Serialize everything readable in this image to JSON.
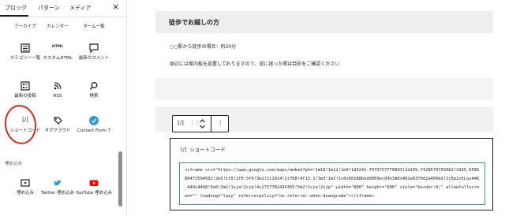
{
  "inserter": {
    "tabs": [
      "ブロック",
      "パターン",
      "メディア"
    ],
    "close_icon": "×",
    "top_row": [
      "アーカイブ",
      "カレンダー",
      "ターム一覧"
    ],
    "rows": [
      {
        "label": "カテゴリー一覧",
        "icon": "category-list-icon"
      },
      {
        "label": "カスタムHTML",
        "icon": "html-icon",
        "icon_text": "HTML"
      },
      {
        "label": "最新のコメント",
        "icon": "comment-icon"
      },
      {
        "label": "最新の投稿",
        "icon": "posts-list-icon"
      },
      {
        "label": "RSS",
        "icon": "rss-icon"
      },
      {
        "label": "検索",
        "icon": "search-icon"
      },
      {
        "label": "ショートコード",
        "icon": "shortcode-icon",
        "icon_text": "[/]"
      },
      {
        "label": "タグクラウド",
        "icon": "tag-icon"
      },
      {
        "label": "Contact Form 7",
        "icon": "contact-form-7-icon"
      }
    ],
    "section_title": "埋め込み",
    "embeds": [
      {
        "label": "埋め込み",
        "icon": "embed-icon"
      },
      {
        "label": "Twitter 埋め込み",
        "icon": "twitter-icon"
      },
      {
        "label": "YouTube 埋め込み",
        "icon": "youtube-icon"
      }
    ],
    "highlight_color": "#e0261b"
  },
  "editor": {
    "heading": "徒歩でお越しの方",
    "para1": "○○駅から徒歩の場合：約20分",
    "para2": "周辺には案内板を設置しておりますので、道に迷った際は目印をご確認ください",
    "toolbar": {
      "block_icon": "[/]",
      "drag_icon": "⋮⋮",
      "more_icon": "⋮"
    },
    "shortcode": {
      "title": "ショートコード",
      "icon": "[/]",
      "code": "<iframe src=\"https://www.google.com/maps/embed?pb=!1m18!1m12!1m3!1d3241.7479757770893!2d139.7428579750982!3d35.658580472594582!2m3!1f0!2f0!3f0!3m2!1i1024!2i768!4f13.1!3m3!1m2!1s0x60188bbd9009ec09%3A0x481a93f0d2a409dd!2z5p2x5Lqs44K_44Ov44O8!5e0!3m2!1sja!2sjp!4v1757782434355!5m2!1sja!2sjp\" width=\"800\" height=\"600\" style=\"border:0;\" allowfullscreen=\"\" loading=\"lazy\" referrerpolicy=\"no-referrer-when-downgrade\"></iframe>"
    },
    "accent_color": "#3a8fd6"
  }
}
